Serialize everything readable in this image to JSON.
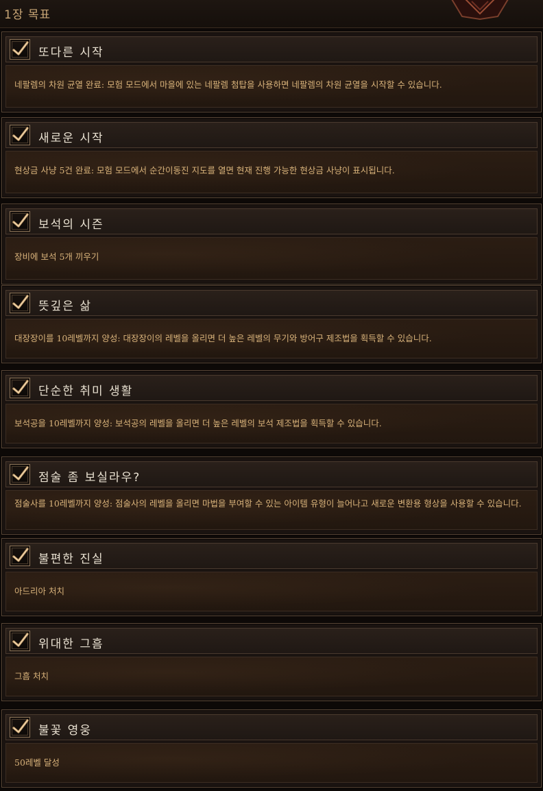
{
  "header": {
    "title": "1장 목표"
  },
  "achievements": [
    {
      "title": "또다른 시작",
      "description": "네팔렘의 차원 균열 완료: 모험 모드에서 마을에 있는 네팔렘 첨탑을 사용하면 네팔렘의 차원 균열을 시작할 수 있습니다.",
      "completed": true
    },
    {
      "title": "새로운 시작",
      "description": "현상금 사냥 5건 완료: 모험 모드에서 순간이동진 지도를 열면 현재 진행 가능한 현상금 사냥이 표시됩니다.",
      "completed": true
    },
    {
      "title": "보석의 시즌",
      "description": "장비에 보석 5개 끼우기",
      "completed": true
    },
    {
      "title": "뜻깊은 삶",
      "description": "대장장이를 10레벨까지 양성: 대장장이의 레벨을 올리면 더 높은 레벨의 무기와 방어구 제조법을 획득할 수 있습니다.",
      "completed": true
    },
    {
      "title": "단순한 취미 생활",
      "description": "보석공을 10레벨까지 양성: 보석공의 레벨을 올리면 더 높은 레벨의 보석 제조법을 획득할 수 있습니다.",
      "completed": true
    },
    {
      "title": "점술 좀 보실라우?",
      "description": "점술사를 10레벨까지 양성: 점술사의 레벨을 올리면 마법을 부여할 수 있는 아이템 유형이 늘어나고 새로운 변환용 형상을 사용할 수 있습니다.",
      "completed": true
    },
    {
      "title": "불편한 진실",
      "description": "아드리아 처치",
      "completed": true
    },
    {
      "title": "위대한 그흠",
      "description": "그흠 처치",
      "completed": true
    },
    {
      "title": "불꽃 영웅",
      "description": "50레벨 달성",
      "completed": true
    }
  ],
  "icons": {
    "check": "checkmark-icon"
  },
  "colors": {
    "title_text": "#e9e1d1",
    "description_text": "#d8b27a",
    "check_gold": "#c9a06b"
  }
}
